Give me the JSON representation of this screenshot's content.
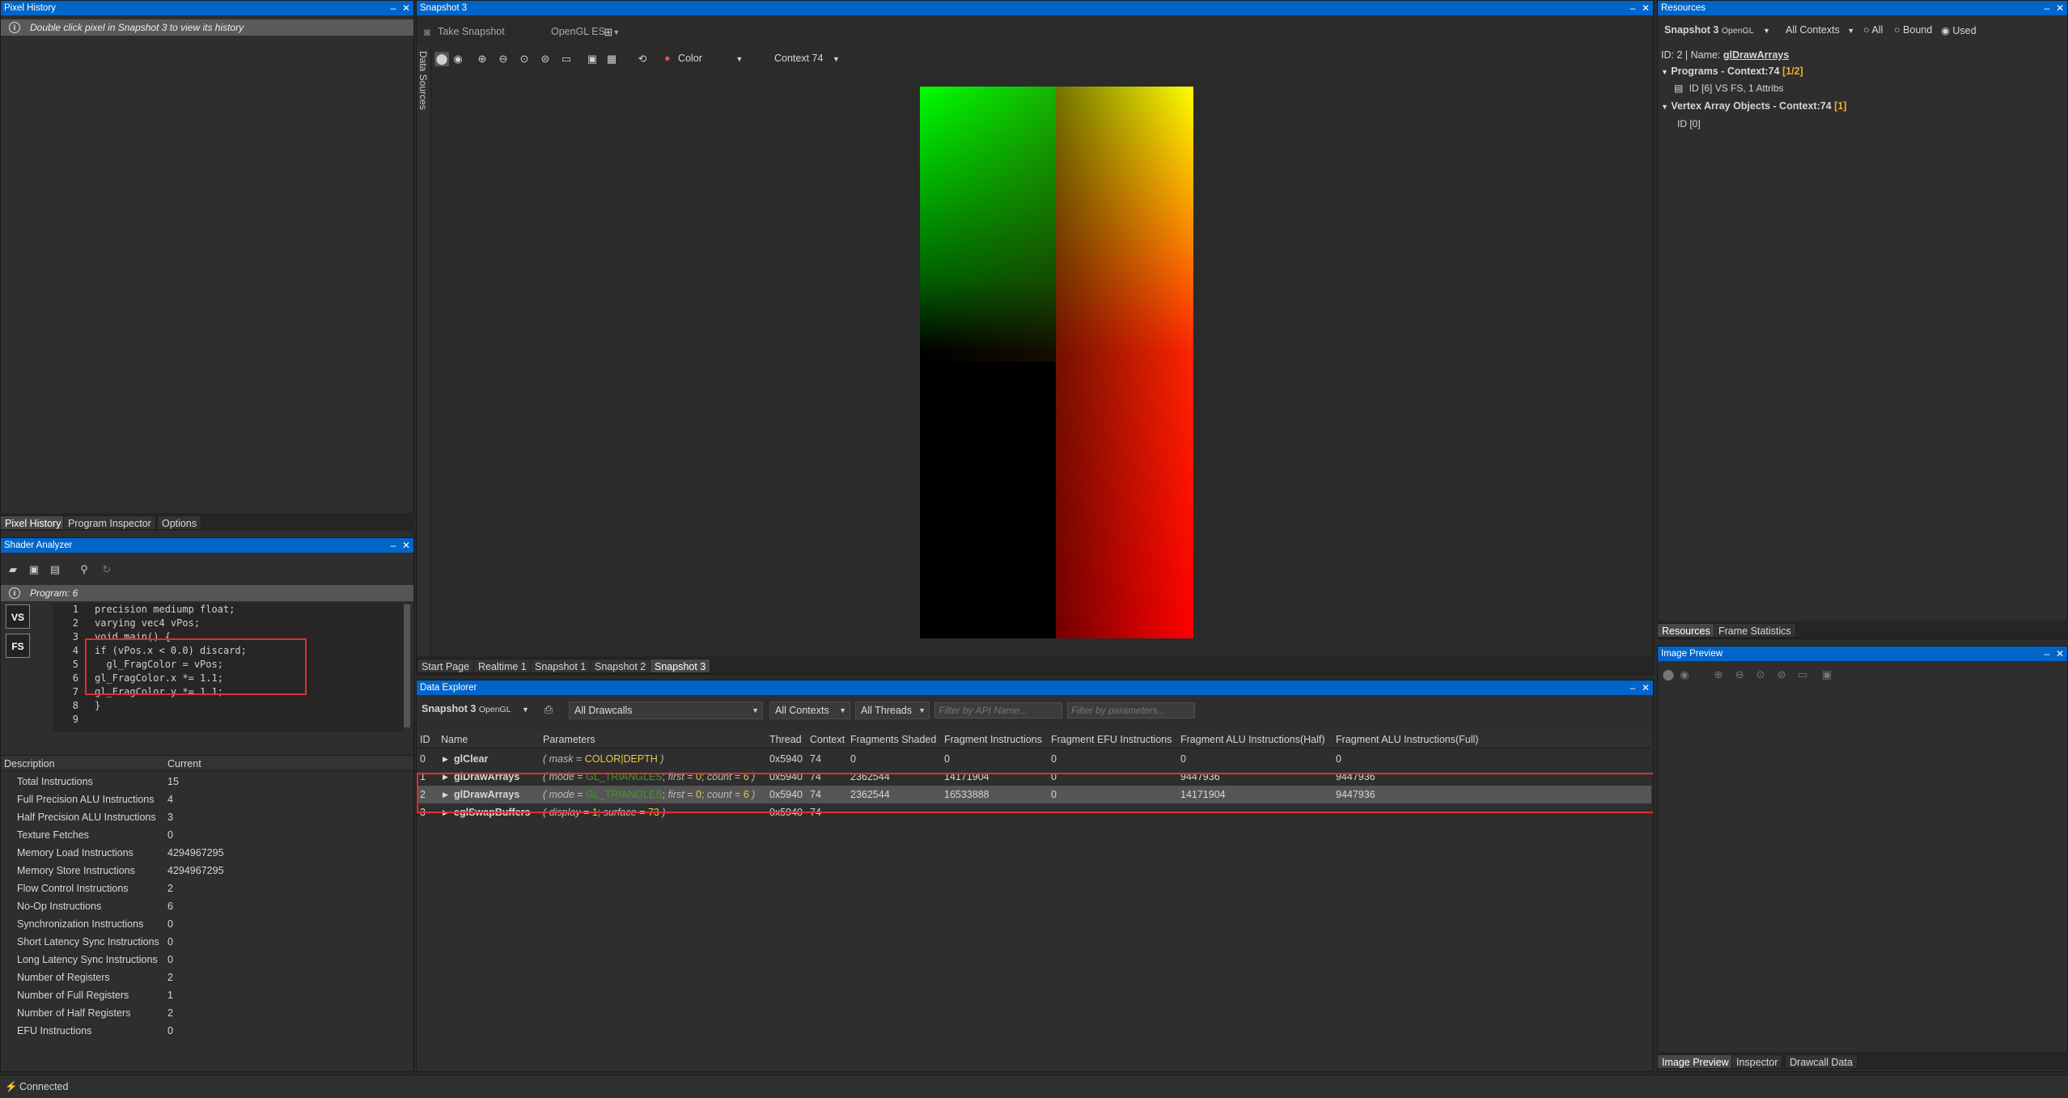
{
  "pixel_history": {
    "title": "Pixel History",
    "hint": "Double click pixel in Snapshot 3 to view its history",
    "tabs": [
      "Pixel History",
      "Program Inspector",
      "Options"
    ]
  },
  "shader_analyzer": {
    "title": "Shader Analyzer",
    "program_label": "Program: 6",
    "stage_vs": "VS",
    "stage_fs": "FS",
    "code_lines": [
      {
        "n": "1",
        "text": "precision mediump float;"
      },
      {
        "n": "2",
        "text": "varying vec4 vPos;"
      },
      {
        "n": "3",
        "text": "void main() {"
      },
      {
        "n": "4",
        "text": "if (vPos.x < 0.0) discard;"
      },
      {
        "n": "5",
        "text": "  gl_FragColor = vPos;"
      },
      {
        "n": "6",
        "text": "gl_FragColor.x *= 1.1;"
      },
      {
        "n": "7",
        "text": "gl_FragColor.y *= 1.1;"
      },
      {
        "n": "8",
        "text": "}"
      },
      {
        "n": "9",
        "text": ""
      }
    ],
    "stats_header": {
      "description": "Description",
      "current": "Current"
    },
    "stats": [
      {
        "desc": "Total Instructions",
        "value": "15"
      },
      {
        "desc": "Full Precision ALU Instructions",
        "value": "4"
      },
      {
        "desc": "Half Precision ALU Instructions",
        "value": "3"
      },
      {
        "desc": "Texture Fetches",
        "value": "0"
      },
      {
        "desc": "Memory Load Instructions",
        "value": "4294967295"
      },
      {
        "desc": "Memory Store Instructions",
        "value": "4294967295"
      },
      {
        "desc": "Flow Control Instructions",
        "value": "2"
      },
      {
        "desc": "No-Op Instructions",
        "value": "6"
      },
      {
        "desc": "Synchronization Instructions",
        "value": "0"
      },
      {
        "desc": "Short Latency Sync Instructions",
        "value": "0"
      },
      {
        "desc": "Long Latency Sync Instructions",
        "value": "0"
      },
      {
        "desc": "Number of Registers",
        "value": "2"
      },
      {
        "desc": "Number of Full Registers",
        "value": "1"
      },
      {
        "desc": "Number of Half Registers",
        "value": "2"
      },
      {
        "desc": "EFU Instructions",
        "value": "0"
      }
    ]
  },
  "snapshot": {
    "title": "Snapshot 3",
    "take_snapshot": "Take Snapshot",
    "api": "OpenGL ES",
    "side_tab": "Data Sources",
    "color_mode": "Color",
    "context": "Context 74",
    "tabs": [
      "Start Page",
      "Realtime 1",
      "Snapshot 1",
      "Snapshot 2",
      "Snapshot 3"
    ]
  },
  "data_explorer": {
    "title": "Data Explorer",
    "snapshot_label": "Snapshot 3",
    "snapshot_api": "OpenGL",
    "drawcalls_filter": "All Drawcalls",
    "contexts_filter": "All Contexts",
    "threads_filter": "All Threads",
    "api_filter_placeholder": "Filter by API Name...",
    "param_filter_placeholder": "Filter by parameters...",
    "columns": [
      "ID",
      "Name",
      "Parameters",
      "Thread",
      "Context",
      "Fragments Shaded",
      "Fragment Instructions",
      "Fragment EFU Instructions",
      "Fragment ALU Instructions(Half)",
      "Fragment ALU Instructions(Full)"
    ],
    "rows": [
      {
        "id": "0",
        "name": "glClear",
        "p_open": "( ",
        "p1k": "mask",
        "p1v": "COLOR|DEPTH",
        "p2k": "",
        "p2v": "",
        "p3k": "",
        "p3v": "",
        "p_close": " )",
        "thread": "0x5940",
        "context": "74",
        "frags": "0",
        "finstr": "0",
        "efu": "0",
        "alu_half": "0",
        "alu_full": "0"
      },
      {
        "id": "1",
        "name": "glDrawArrays",
        "p_open": "( ",
        "p1k": "mode",
        "p1v": "GL_TRIANGLES",
        "p2k": "first",
        "p2v": "0",
        "p3k": "count",
        "p3v": "6",
        "p_close": " )",
        "thread": "0x5940",
        "context": "74",
        "frags": "2362544",
        "finstr": "14171904",
        "efu": "0",
        "alu_half": "9447936",
        "alu_full": "9447936"
      },
      {
        "id": "2",
        "name": "glDrawArrays",
        "p_open": "( ",
        "p1k": "mode",
        "p1v": "GL_TRIANGLES",
        "p2k": "first",
        "p2v": "0",
        "p3k": "count",
        "p3v": "6",
        "p_close": " )",
        "thread": "0x5940",
        "context": "74",
        "frags": "2362544",
        "finstr": "16533888",
        "efu": "0",
        "alu_half": "14171904",
        "alu_full": "9447936"
      },
      {
        "id": "3",
        "name": "eglSwapBuffers",
        "p_open": "( ",
        "p1k": "display",
        "p1v": "1",
        "p2k": "surface",
        "p2v": "73",
        "p3k": "",
        "p3v": "",
        "p_close": " )",
        "thread": "0x5940",
        "context": "74",
        "frags": "",
        "finstr": "",
        "efu": "",
        "alu_half": "",
        "alu_full": ""
      }
    ]
  },
  "resources": {
    "title": "Resources",
    "snapshot_label": "Snapshot 3",
    "snapshot_api": "OpenGL",
    "contexts_filter": "All Contexts",
    "radio_all": "All",
    "radio_bound": "Bound",
    "radio_used": "Used",
    "id_line_prefix": "ID: 2 | Name: ",
    "id_line_name": "glDrawArrays",
    "programs_group": "Programs - Context:74",
    "programs_count": "[1/2]",
    "program_item": "ID [6] VS FS, 1 Attribs",
    "vao_group": "Vertex Array Objects - Context:74",
    "vao_count": "[1]",
    "vao_item": "ID [0]",
    "tabs": [
      "Resources",
      "Frame Statistics"
    ]
  },
  "image_preview": {
    "title": "Image Preview",
    "tabs": [
      "Image Preview",
      "Inspector",
      "Drawcall Data"
    ]
  },
  "status": {
    "text": "Connected"
  },
  "colors": {
    "accent": "#0065c8",
    "highlight_box": "#e03030",
    "selected_row": "#555555"
  }
}
